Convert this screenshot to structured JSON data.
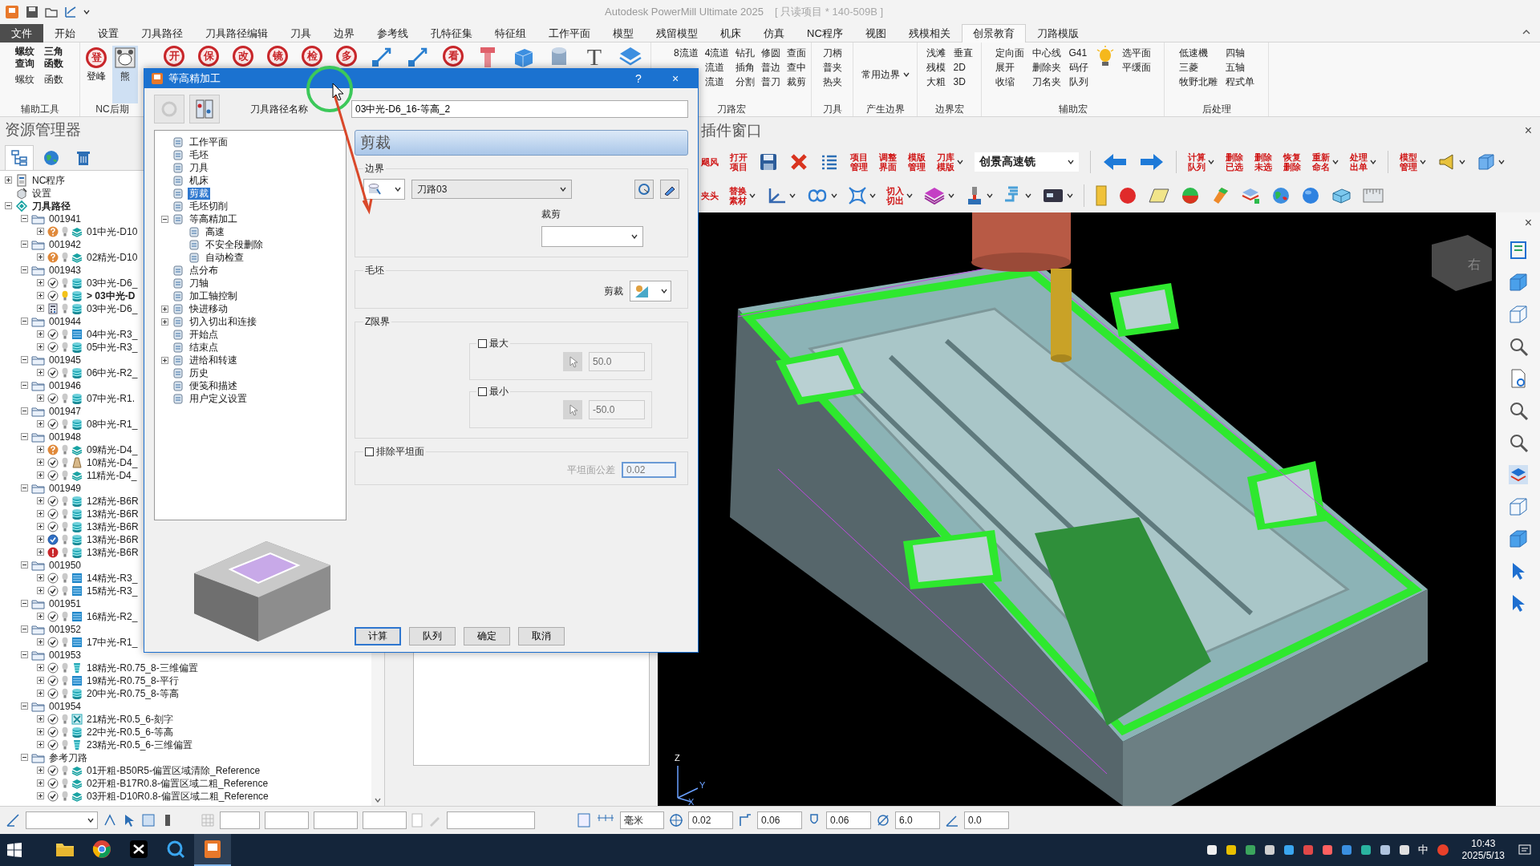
{
  "title_bar": {
    "title": "Autodesk PowerMill Ultimate 2025",
    "project": "[ 只读项目 * 140-509B ]"
  },
  "menu_tabs": [
    {
      "label": "文件",
      "kind": "file",
      "selected": false
    },
    {
      "label": "开始",
      "kind": "tab",
      "selected": false
    },
    {
      "label": "设置",
      "kind": "tab",
      "selected": false
    },
    {
      "label": "刀具路径",
      "kind": "tab",
      "selected": false
    },
    {
      "label": "刀具路径编辑",
      "kind": "tab",
      "selected": false
    },
    {
      "label": "刀具",
      "kind": "tab",
      "selected": false
    },
    {
      "label": "边界",
      "kind": "tab",
      "selected": false
    },
    {
      "label": "参考线",
      "kind": "tab",
      "selected": false
    },
    {
      "label": "孔特征集",
      "kind": "tab",
      "selected": false
    },
    {
      "label": "特征组",
      "kind": "tab",
      "selected": false
    },
    {
      "label": "工作平面",
      "kind": "tab",
      "selected": false
    },
    {
      "label": "模型",
      "kind": "tab",
      "selected": false
    },
    {
      "label": "残留模型",
      "kind": "tab",
      "selected": false
    },
    {
      "label": "机床",
      "kind": "tab",
      "selected": false
    },
    {
      "label": "仿真",
      "kind": "tab",
      "selected": false
    },
    {
      "label": "NC程序",
      "kind": "tab",
      "selected": false
    },
    {
      "label": "视图",
      "kind": "tab",
      "selected": false
    },
    {
      "label": "残模相关",
      "kind": "tab",
      "selected": false
    },
    {
      "label": "创景教育",
      "kind": "tab",
      "selected": true
    },
    {
      "label": "刀路模版",
      "kind": "tab",
      "selected": false
    }
  ],
  "ribbon": {
    "groups": [
      {
        "kind": "text",
        "label": "辅助工具",
        "columns": [
          [
            {
              "text": "螺纹查询",
              "bold": true
            },
            {
              "text": "螺纹",
              "bold": false
            }
          ],
          [
            {
              "text": "三角函数",
              "bold": true
            },
            {
              "text": "函数",
              "bold": false
            }
          ]
        ]
      },
      {
        "kind": "buttons",
        "label": "NC后期",
        "buttons": [
          {
            "glyph": "登",
            "label": "登峰",
            "selected": false
          },
          {
            "label": "熊",
            "selected": true
          }
        ]
      },
      {
        "kind": "stamps",
        "items": [
          {
            "kind": "stamp",
            "glyph": "开"
          },
          {
            "kind": "stamp",
            "glyph": "保"
          },
          {
            "kind": "stamp",
            "glyph": "改"
          },
          {
            "kind": "stamp",
            "glyph": "镜"
          },
          {
            "kind": "stamp",
            "glyph": "检"
          },
          {
            "kind": "stamp",
            "glyph": "多"
          },
          {
            "kind": "arrow"
          },
          {
            "kind": "arrow"
          },
          {
            "kind": "stamp",
            "glyph": "看"
          },
          {
            "kind": "tool"
          },
          {
            "kind": "cube"
          },
          {
            "kind": "cylinder"
          },
          {
            "kind": "type",
            "glyph": "T"
          },
          {
            "kind": "layers"
          }
        ]
      },
      {
        "kind": "text",
        "label": "刀路宏",
        "columns": [
          [
            {
              "text": "8流道"
            }
          ],
          [
            {
              "text": "4流道"
            },
            {
              "text": "流道"
            },
            {
              "text": "流道"
            }
          ],
          [
            {
              "text": "钻孔"
            },
            {
              "text": "插角"
            },
            {
              "text": "分割"
            }
          ],
          [
            {
              "text": "修圆"
            },
            {
              "text": "普边"
            },
            {
              "text": "普刀"
            }
          ],
          [
            {
              "text": "查面"
            },
            {
              "text": "查中"
            },
            {
              "text": "裁剪"
            }
          ]
        ]
      },
      {
        "kind": "text",
        "label": "刀具",
        "columns": [
          [
            {
              "text": "刀柄"
            },
            {
              "text": "普夹"
            },
            {
              "text": "热夹"
            }
          ]
        ]
      },
      {
        "kind": "dropdown",
        "label": "产生边界",
        "text": "常用边界"
      },
      {
        "kind": "text",
        "label": "边界宏",
        "columns": [
          [
            {
              "text": "浅滩"
            },
            {
              "text": "残模"
            },
            {
              "text": "大粗"
            }
          ],
          [
            {
              "text": "垂直"
            },
            {
              "text": "2D"
            },
            {
              "text": "3D"
            }
          ]
        ]
      },
      {
        "kind": "macro",
        "label": "辅助宏",
        "columns": [
          [
            {
              "text": "定向面"
            },
            {
              "text": "展开"
            },
            {
              "text": "收缩"
            }
          ],
          [
            {
              "text": "中心线"
            },
            {
              "text": "删除夹"
            },
            {
              "text": "刀名夹"
            }
          ],
          [
            {
              "text": "G41"
            },
            {
              "text": "码仔"
            },
            {
              "text": "队列"
            }
          ]
        ],
        "side_columns": [
          [
            {
              "text": "选平面"
            },
            {
              "text": "平缓面"
            }
          ]
        ]
      },
      {
        "kind": "text",
        "label": "后处理",
        "columns": [
          [
            {
              "text": "低速機"
            },
            {
              "text": "三菱"
            },
            {
              "text": "牧野北雕"
            }
          ],
          [
            {
              "text": "四轴"
            },
            {
              "text": "五轴"
            },
            {
              "text": "程式单"
            }
          ]
        ]
      }
    ]
  },
  "explorer": {
    "title": "资源管理器",
    "tabs": [
      {
        "kind": "tree",
        "selected": true
      },
      {
        "kind": "globe",
        "selected": false
      },
      {
        "kind": "trash",
        "selected": false
      }
    ],
    "tree": [
      {
        "label": "NC程序",
        "kind": "nc",
        "expanded": false
      },
      {
        "label": "设置",
        "kind": "setup"
      },
      {
        "label": "刀具路径",
        "kind": "root",
        "expanded": true,
        "children": [
          {
            "label": "001941",
            "kind": "folder",
            "expanded": true,
            "children": [
              {
                "label": "01中光-D10",
                "kind": "toolpath",
                "expanded": false,
                "status": {
                  "kind": "question"
                },
                "pattern": {
                  "kind": "raster"
                },
                "active": false
              }
            ]
          },
          {
            "label": "001942",
            "kind": "folder",
            "expanded": true,
            "children": [
              {
                "label": "02精光-D10",
                "kind": "toolpath",
                "expanded": false,
                "status": {
                  "kind": "question"
                },
                "pattern": {
                  "kind": "raster"
                },
                "active": false
              }
            ]
          },
          {
            "label": "001943",
            "kind": "folder",
            "expanded": true,
            "children": [
              {
                "label": "03中光-D6_",
                "kind": "toolpath",
                "expanded": false,
                "status": {
                  "kind": "ok"
                },
                "pattern": {
                  "kind": "zlevel"
                },
                "active": false
              },
              {
                "label": "> 03中光-D",
                "kind": "toolpath",
                "expanded": false,
                "status": {
                  "kind": "ok"
                },
                "pattern": {
                  "kind": "zlevel"
                },
                "active": true
              },
              {
                "label": "03中光-D6_",
                "kind": "toolpath",
                "expanded": false,
                "status": {
                  "kind": "calc"
                },
                "pattern": {
                  "kind": "zlevel"
                },
                "active": false
              }
            ]
          },
          {
            "label": "001944",
            "kind": "folder",
            "expanded": true,
            "children": [
              {
                "label": "04中光-R3_",
                "kind": "toolpath",
                "expanded": false,
                "status": {
                  "kind": "ok"
                },
                "pattern": {
                  "kind": "flat"
                },
                "active": false
              },
              {
                "label": "05中光-R3_",
                "kind": "toolpath",
                "expanded": false,
                "status": {
                  "kind": "ok"
                },
                "pattern": {
                  "kind": "zlevel"
                },
                "active": false
              }
            ]
          },
          {
            "label": "001945",
            "kind": "folder",
            "expanded": true,
            "children": [
              {
                "label": "06中光-R2_",
                "kind": "toolpath",
                "expanded": false,
                "status": {
                  "kind": "ok"
                },
                "pattern": {
                  "kind": "zlevel"
                },
                "active": false
              }
            ]
          },
          {
            "label": "001946",
            "kind": "folder",
            "expanded": true,
            "children": [
              {
                "label": "07中光-R1.",
                "kind": "toolpath",
                "expanded": false,
                "status": {
                  "kind": "ok"
                },
                "pattern": {
                  "kind": "zlevel"
                },
                "active": false
              }
            ]
          },
          {
            "label": "001947",
            "kind": "folder",
            "expanded": true,
            "children": [
              {
                "label": "08中光-R1_",
                "kind": "toolpath",
                "expanded": false,
                "status": {
                  "kind": "ok"
                },
                "pattern": {
                  "kind": "zlevel"
                },
                "active": false
              }
            ]
          },
          {
            "label": "001948",
            "kind": "folder",
            "expanded": true,
            "children": [
              {
                "label": "09精光-D4_",
                "kind": "toolpath",
                "expanded": false,
                "status": {
                  "kind": "question"
                },
                "pattern": {
                  "kind": "raster"
                },
                "active": false
              },
              {
                "label": "10精光-D4_",
                "kind": "toolpath",
                "expanded": false,
                "status": {
                  "kind": "ok"
                },
                "pattern": {
                  "kind": "chisel"
                },
                "active": false
              },
              {
                "label": "11精光-D4_",
                "kind": "toolpath",
                "expanded": false,
                "status": {
                  "kind": "ok"
                },
                "pattern": {
                  "kind": "raster"
                },
                "active": false
              }
            ]
          },
          {
            "label": "001949",
            "kind": "folder",
            "expanded": true,
            "children": [
              {
                "label": "12精光-B6R",
                "kind": "toolpath",
                "expanded": false,
                "status": {
                  "kind": "ok"
                },
                "pattern": {
                  "kind": "zlevel"
                },
                "active": false
              },
              {
                "label": "13精光-B6R",
                "kind": "toolpath",
                "expanded": false,
                "status": {
                  "kind": "ok"
                },
                "pattern": {
                  "kind": "zlevel"
                },
                "active": false
              },
              {
                "label": "13精光-B6R",
                "kind": "toolpath",
                "expanded": false,
                "status": {
                  "kind": "ok"
                },
                "pattern": {
                  "kind": "zlevel"
                },
                "active": false
              },
              {
                "label": "13精光-B6R",
                "kind": "toolpath",
                "expanded": false,
                "status": {
                  "kind": "picked"
                },
                "pattern": {
                  "kind": "zlevel"
                },
                "active": false
              },
              {
                "label": "13精光-B6R",
                "kind": "toolpath",
                "expanded": false,
                "status": {
                  "kind": "error"
                },
                "pattern": {
                  "kind": "zlevel"
                },
                "active": false
              }
            ]
          },
          {
            "label": "001950",
            "kind": "folder",
            "expanded": true,
            "children": [
              {
                "label": "14精光-R3_",
                "kind": "toolpath",
                "expanded": false,
                "status": {
                  "kind": "ok"
                },
                "pattern": {
                  "kind": "flat"
                },
                "active": false
              },
              {
                "label": "15精光-R3_",
                "kind": "toolpath",
                "expanded": false,
                "status": {
                  "kind": "ok"
                },
                "pattern": {
                  "kind": "flat"
                },
                "active": false
              }
            ]
          },
          {
            "label": "001951",
            "kind": "folder",
            "expanded": true,
            "children": [
              {
                "label": "16精光-R2_",
                "kind": "toolpath",
                "expanded": false,
                "status": {
                  "kind": "ok"
                },
                "pattern": {
                  "kind": "flat"
                },
                "active": false
              }
            ]
          },
          {
            "label": "001952",
            "kind": "folder",
            "expanded": true,
            "children": [
              {
                "label": "17中光-R1_",
                "kind": "toolpath",
                "expanded": false,
                "status": {
                  "kind": "ok"
                },
                "pattern": {
                  "kind": "flat"
                },
                "active": false
              }
            ]
          },
          {
            "label": "001953",
            "kind": "folder",
            "expanded": true,
            "children": [
              {
                "label": "18精光-R0.75_8-三维偏置",
                "kind": "toolpath",
                "expanded": false,
                "status": {
                  "kind": "ok"
                },
                "pattern": {
                  "kind": "offset"
                },
                "active": false
              },
              {
                "label": "19精光-R0.75_8-平行",
                "kind": "toolpath",
                "expanded": false,
                "status": {
                  "kind": "ok"
                },
                "pattern": {
                  "kind": "flat"
                },
                "active": false
              },
              {
                "label": "20中光-R0.75_8-等高",
                "kind": "toolpath",
                "expanded": false,
                "status": {
                  "kind": "ok"
                },
                "pattern": {
                  "kind": "zlevel"
                },
                "active": false
              }
            ]
          },
          {
            "label": "001954",
            "kind": "folder",
            "expanded": true,
            "children": [
              {
                "label": "21精光-R0.5_6-刻字",
                "kind": "toolpath",
                "expanded": false,
                "status": {
                  "kind": "ok"
                },
                "pattern": {
                  "kind": "swarf"
                },
                "active": false
              },
              {
                "label": "22中光-R0.5_6-等高",
                "kind": "toolpath",
                "expanded": false,
                "status": {
                  "kind": "ok"
                },
                "pattern": {
                  "kind": "zlevel"
                },
                "active": false
              },
              {
                "label": "23精光-R0.5_6-三维偏置",
                "kind": "toolpath",
                "expanded": false,
                "status": {
                  "kind": "ok"
                },
                "pattern": {
                  "kind": "offset"
                },
                "active": false
              }
            ]
          },
          {
            "label": "参考刀路",
            "kind": "folder",
            "expanded": true,
            "children": [
              {
                "label": "01开粗-B50R5-偏置区域清除_Reference",
                "kind": "toolpath",
                "expanded": false,
                "status": {
                  "kind": "ok"
                },
                "pattern": {
                  "kind": "raster"
                },
                "active": false
              },
              {
                "label": "02开粗-B17R0.8-偏置区域二粗_Reference",
                "kind": "toolpath",
                "expanded": false,
                "status": {
                  "kind": "ok"
                },
                "pattern": {
                  "kind": "raster"
                },
                "active": false
              },
              {
                "label": "03开粗-D10R0.8-偏置区域二粗_Reference",
                "kind": "toolpath",
                "expanded": false,
                "status": {
                  "kind": "ok"
                },
                "pattern": {
                  "kind": "raster"
                },
                "active": false
              }
            ]
          }
        ]
      }
    ]
  },
  "plugin": {
    "title": "插件窗口",
    "close": "×",
    "rows": [
      [
        {
          "kind": "label",
          "text": "飓风",
          "menu": false
        },
        {
          "kind": "label",
          "text": "打开项目",
          "menu": false
        },
        {
          "kind": "icon",
          "menu": false
        },
        {
          "kind": "icon",
          "menu": false
        },
        {
          "kind": "icon",
          "menu": false
        },
        {
          "kind": "label",
          "text": "项目管理",
          "menu": false
        },
        {
          "kind": "label",
          "text": "调整界面",
          "menu": false
        },
        {
          "kind": "label",
          "text": "模版管理",
          "menu": false
        },
        {
          "kind": "label",
          "text": "刀库模版",
          "menu": true
        },
        {
          "kind": "select",
          "value": "创景高速铣"
        },
        {
          "kind": "separator"
        },
        {
          "kind": "icon",
          "menu": false
        },
        {
          "kind": "icon",
          "menu": false
        },
        {
          "kind": "separator"
        },
        {
          "kind": "label",
          "text": "计算队列",
          "menu": true
        },
        {
          "kind": "label",
          "text": "删除已选",
          "menu": false
        },
        {
          "kind": "label",
          "text": "删除未选",
          "menu": false
        },
        {
          "kind": "label",
          "text": "恢复删除",
          "menu": false
        },
        {
          "kind": "label",
          "text": "重新命名",
          "menu": true
        },
        {
          "kind": "label",
          "text": "处理出单",
          "menu": true
        },
        {
          "kind": "separator"
        },
        {
          "kind": "label",
          "text": "模型管理",
          "menu": true
        },
        {
          "kind": "icon",
          "menu": true
        },
        {
          "kind": "icon",
          "menu": true
        }
      ],
      [
        {
          "kind": "label",
          "text": "夹头",
          "menu": false
        },
        {
          "kind": "label",
          "text": "替换素材",
          "menu": true
        },
        {
          "kind": "icon",
          "menu": true
        },
        {
          "kind": "icon",
          "menu": true
        },
        {
          "kind": "icon",
          "menu": true
        },
        {
          "kind": "label",
          "text": "切入切出",
          "menu": true
        },
        {
          "kind": "icon",
          "menu": true
        },
        {
          "kind": "icon",
          "menu": true
        },
        {
          "kind": "icon",
          "menu": true
        },
        {
          "kind": "icon",
          "menu": true
        },
        {
          "kind": "separator"
        },
        {
          "kind": "icon",
          "menu": false
        },
        {
          "kind": "icon",
          "menu": false
        },
        {
          "kind": "icon",
          "menu": false
        },
        {
          "kind": "icon",
          "menu": false
        },
        {
          "kind": "icon",
          "menu": false
        },
        {
          "kind": "icon",
          "menu": false
        },
        {
          "kind": "icon",
          "menu": false
        },
        {
          "kind": "icon",
          "menu": false
        },
        {
          "kind": "icon",
          "menu": false
        },
        {
          "kind": "icon",
          "menu": false
        }
      ]
    ]
  },
  "viewport": {
    "close": "×",
    "view_cube": "右",
    "axes": [
      "Z",
      "Y",
      "X"
    ]
  },
  "dialog": {
    "title": "等高精加工",
    "help": "?",
    "close": "×",
    "name_label": "刀具路径名称",
    "name_value": "03中光-D6_16-等高_2",
    "tree": [
      {
        "label": "工作平面",
        "selected": false
      },
      {
        "label": "毛坯",
        "selected": false
      },
      {
        "label": "刀具",
        "selected": false
      },
      {
        "label": "机床",
        "selected": false
      },
      {
        "label": "剪裁",
        "selected": true
      },
      {
        "label": "毛坯切削",
        "selected": false
      },
      {
        "label": "等高精加工",
        "selected": false,
        "expanded": true,
        "children": [
          {
            "label": "高速",
            "selected": false
          },
          {
            "label": "不安全段删除",
            "selected": false
          },
          {
            "label": "自动检查",
            "selected": false
          }
        ]
      },
      {
        "label": "点分布",
        "selected": false
      },
      {
        "label": "刀轴",
        "selected": false
      },
      {
        "label": "加工轴控制",
        "selected": false
      },
      {
        "label": "快进移动",
        "selected": false,
        "expanded": false
      },
      {
        "label": "切入切出和连接",
        "selected": false,
        "expanded": false
      },
      {
        "label": "开始点",
        "selected": false
      },
      {
        "label": "结束点",
        "selected": false
      },
      {
        "label": "进给和转速",
        "selected": false,
        "expanded": false
      },
      {
        "label": "历史",
        "selected": false
      },
      {
        "label": "便笺和描述",
        "selected": false
      },
      {
        "label": "用户定义设置",
        "selected": false
      }
    ],
    "page_title": "剪裁",
    "boundary": {
      "legend": "边界",
      "value": "刀路03",
      "trim_label": "裁剪"
    },
    "stock": {
      "legend": "毛坯",
      "label": "剪裁"
    },
    "z_limits": {
      "legend": "Z限界",
      "max": {
        "label": "最大",
        "checked": false,
        "value": "50.0"
      },
      "min": {
        "label": "最小",
        "checked": false,
        "value": "-50.0"
      }
    },
    "flat": {
      "label": "排除平坦面",
      "checked": false,
      "tolerance_label": "平坦面公差",
      "tolerance": "0.02"
    },
    "buttons": [
      {
        "label": "计算",
        "default": true
      },
      {
        "label": "队列",
        "default": false
      },
      {
        "label": "确定",
        "default": false
      },
      {
        "label": "取消",
        "default": false
      }
    ]
  },
  "status_bar": {
    "unit": "毫米",
    "fields": [
      {
        "kind": "tolerance",
        "value": "0.02"
      },
      {
        "kind": "thickness",
        "value": "0.06"
      },
      {
        "kind": "axial",
        "value": "0.06"
      },
      {
        "kind": "diameter",
        "value": "6.0"
      },
      {
        "kind": "angle",
        "value": "0.0"
      }
    ]
  },
  "taskbar": {
    "apps": [
      {
        "kind": "files",
        "selected": false
      },
      {
        "kind": "browser",
        "selected": false
      },
      {
        "kind": "editor",
        "selected": false
      },
      {
        "kind": "search",
        "selected": false
      },
      {
        "kind": "powermill",
        "selected": true
      }
    ],
    "ime": "中",
    "time": "10:43",
    "date": "2025/5/13"
  }
}
